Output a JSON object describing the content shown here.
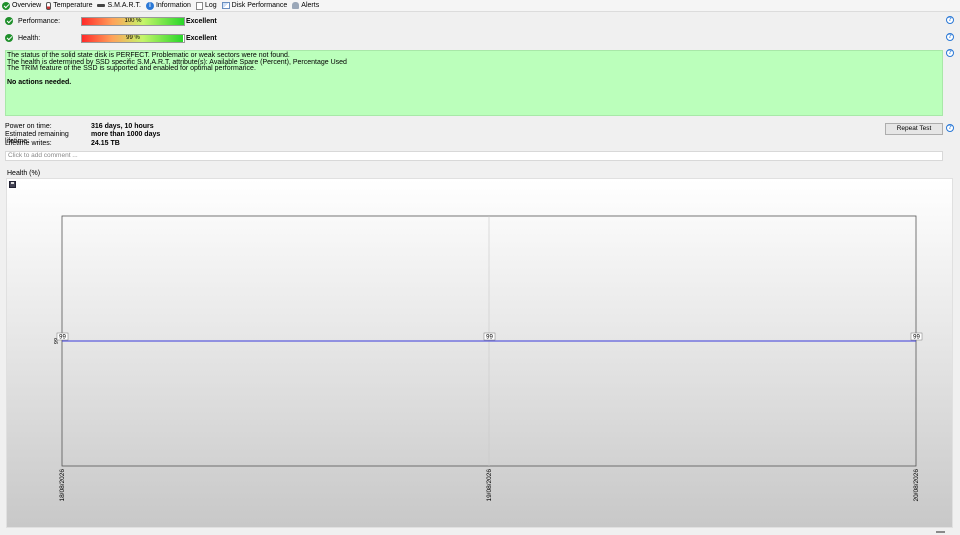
{
  "tabs": [
    {
      "label": "Overview",
      "icon": "check-icon"
    },
    {
      "label": "Temperature",
      "icon": "thermometer-icon"
    },
    {
      "label": "S.M.A.R.T.",
      "icon": "smart-icon"
    },
    {
      "label": "Information",
      "icon": "info-icon"
    },
    {
      "label": "Log",
      "icon": "log-icon"
    },
    {
      "label": "Disk Performance",
      "icon": "chart-icon"
    },
    {
      "label": "Alerts",
      "icon": "bell-icon"
    }
  ],
  "performance": {
    "label": "Performance:",
    "value": 100,
    "percent_text": "100 %",
    "rating": "Excellent"
  },
  "health": {
    "label": "Health:",
    "value": 99,
    "percent_text": "99 %",
    "rating": "Excellent"
  },
  "status": {
    "line1": "The status of the solid state disk is PERFECT. Problematic or weak sectors were not found.",
    "line2": "The health is determined by SSD specific S.M.A.R.T. attribute(s):  Available Spare (Percent), Percentage Used",
    "line3": "The TRIM feature of the SSD is supported and enabled for optimal performance.",
    "action": "No actions needed.",
    "color": "#bbffbb"
  },
  "info": {
    "power_on_label": "Power on time:",
    "power_on_value": "316 days, 10 hours",
    "remaining_label": "Estimated remaining lifetime:",
    "remaining_value": "more than 1000 days",
    "writes_label": "Lifetime writes:",
    "writes_value": "24.15 TB"
  },
  "repeat_button": "Repeat Test",
  "comment_placeholder": "Click to add comment ...",
  "graph": {
    "title": "Health (%)"
  },
  "chart_data": {
    "type": "line",
    "x": [
      "18/08/2026",
      "19/08/2026",
      "20/08/2026"
    ],
    "series": [
      {
        "values": [
          99,
          99,
          99
        ],
        "color": "#3b3bd9"
      }
    ],
    "data_labels": [
      "99",
      "99",
      "99"
    ],
    "y_tick_labels": [
      "99"
    ],
    "ylim": [
      98.5,
      99.5
    ],
    "grid": true
  }
}
